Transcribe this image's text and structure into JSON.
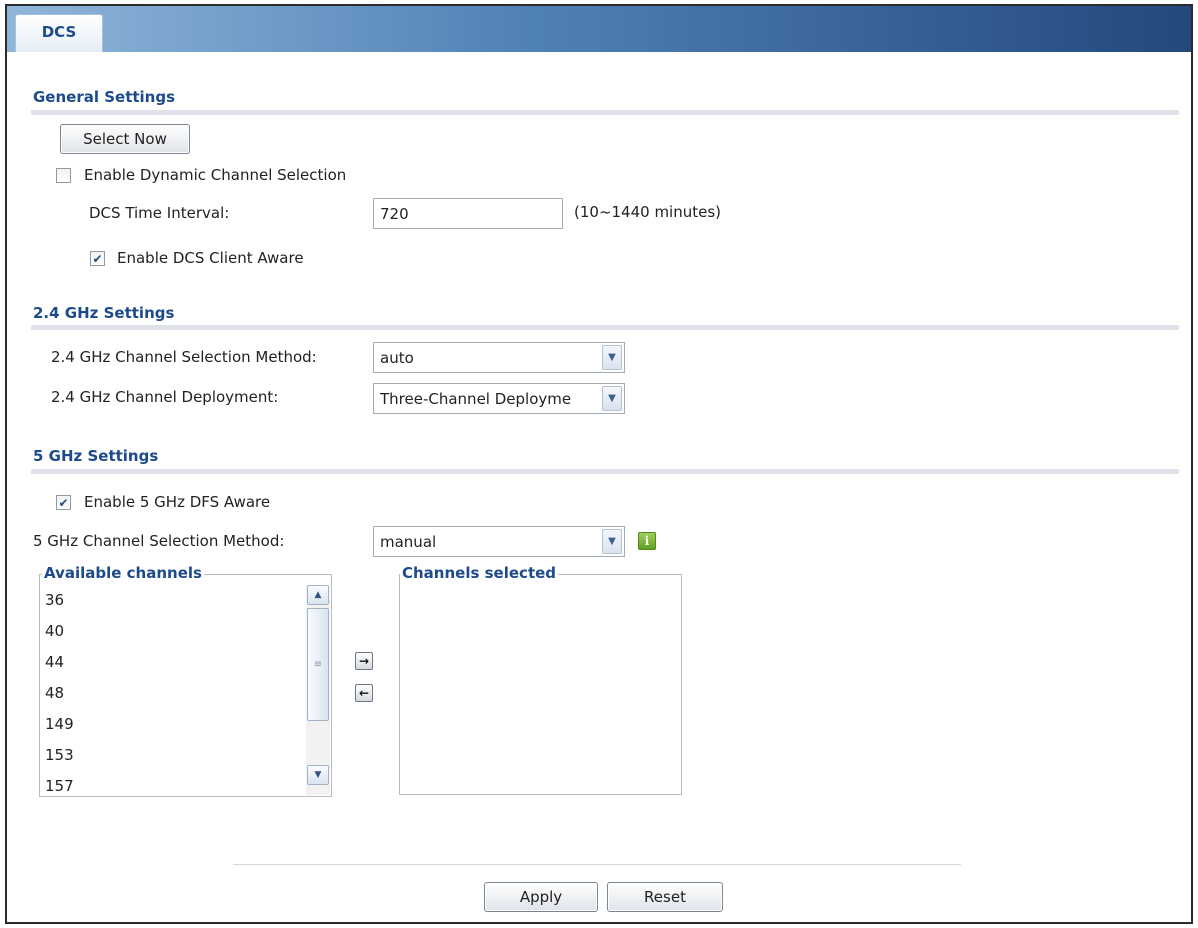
{
  "tab": {
    "label": "DCS"
  },
  "general": {
    "title": "General Settings",
    "select_now_label": "Select Now",
    "enable_dcs_label": "Enable Dynamic Channel Selection",
    "enable_dcs_checked": false,
    "time_interval_label": "DCS Time Interval:",
    "time_interval_value": "720",
    "time_interval_hint": "(10~1440 minutes)",
    "client_aware_label": "Enable DCS Client Aware",
    "client_aware_checked": true
  },
  "ghz24": {
    "title": "2.4 GHz Settings",
    "method_label": "2.4 GHz Channel Selection Method:",
    "method_value": "auto",
    "deployment_label": "2.4 GHz Channel Deployment:",
    "deployment_value": "Three-Channel Deployme"
  },
  "ghz5": {
    "title": "5 GHz Settings",
    "dfs_label": "Enable 5 GHz DFS Aware",
    "dfs_checked": true,
    "method_label": "5 GHz Channel Selection Method:",
    "method_value": "manual",
    "available_title": "Available channels",
    "available_channels": [
      "36",
      "40",
      "44",
      "48",
      "149",
      "153",
      "157"
    ],
    "selected_title": "Channels selected",
    "selected_channels": []
  },
  "actions": {
    "apply_label": "Apply",
    "reset_label": "Reset"
  },
  "icons": {
    "checkmark": "check-icon",
    "info": "info-icon",
    "move_right": "arrow-right-icon",
    "move_left": "arrow-left-icon"
  },
  "colors": {
    "section_title": "#1d4a8a",
    "tabbar_start": "#8fb6d9",
    "tabbar_end": "#23487c",
    "info_green": "#5f9e25"
  }
}
